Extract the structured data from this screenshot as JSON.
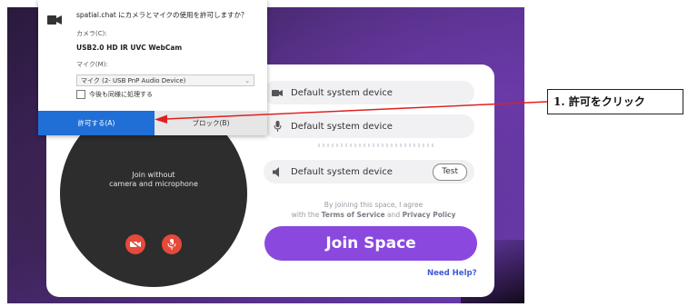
{
  "popup": {
    "title": "spatial.chat にカメラとマイクの使用を許可しますか？",
    "camera_label": "カメラ(C):",
    "camera_device": "USB2.0 HD IR UVC WebCam",
    "mic_label": "マイク(M):",
    "mic_device": "マイク (2- USB PnP Audio Device)",
    "remember_label": "今後も同様に処理する",
    "allow_button": "許可する(A)",
    "block_button": "ブロック(B)"
  },
  "camera_preview": {
    "line1": "Join without",
    "line2": "camera and microphone"
  },
  "devices": {
    "camera": "Default system device",
    "microphone": "Default system device",
    "speaker": "Default system device",
    "test_button": "Test"
  },
  "agreement": {
    "line1": "By joining this space, I agree",
    "prefix": "with the",
    "terms": "Terms of Service",
    "and": "and",
    "privacy": "Privacy Policy"
  },
  "join_button": "Join Space",
  "help_link": "Need Help?",
  "annotation": "1.  許可をクリック",
  "colors": {
    "accent": "#8a48df",
    "allow_blue": "#1f6fd6",
    "arrow_red": "#e02020",
    "mute_red": "#e54a3a"
  }
}
